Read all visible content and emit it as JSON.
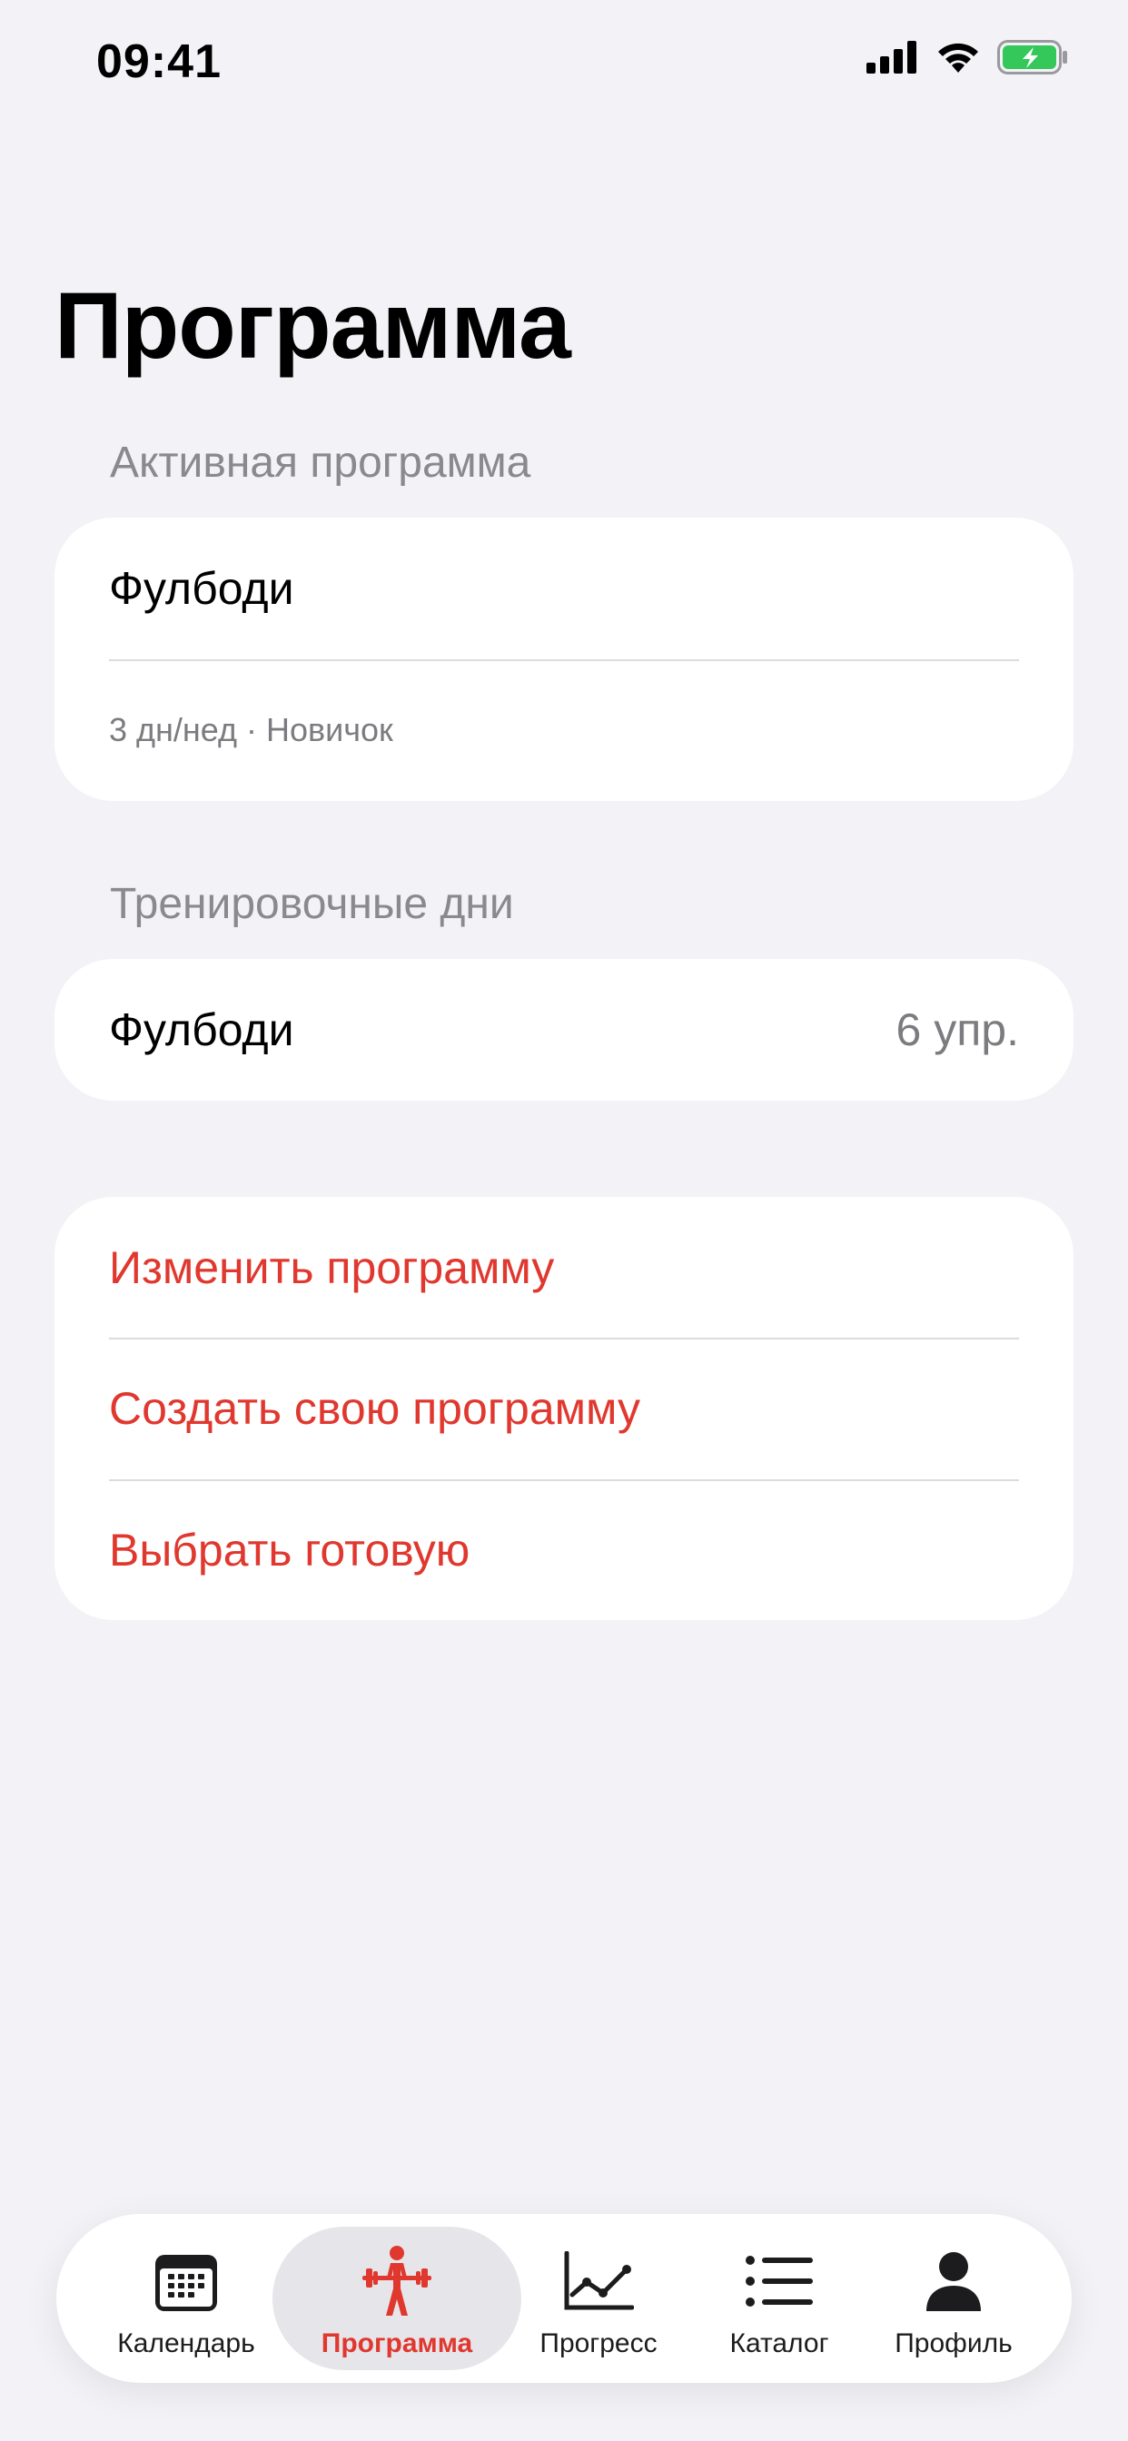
{
  "status_bar": {
    "time": "09:41",
    "icons": [
      "cellular-signal-icon",
      "wifi-icon",
      "battery-charging-icon"
    ],
    "battery_color": "#34C759"
  },
  "page": {
    "title": "Программа"
  },
  "active_program": {
    "header": "Активная программа",
    "name": "Фулбоди",
    "details": "3 дн/нед · Новичок"
  },
  "training_days": {
    "header": "Тренировочные дни",
    "items": [
      {
        "name": "Фулбоди",
        "exercises": "6 упр."
      }
    ]
  },
  "actions": {
    "items": [
      {
        "label": "Изменить программу"
      },
      {
        "label": "Создать свою программу"
      },
      {
        "label": "Выбрать готовую"
      }
    ],
    "color": "#E0382F"
  },
  "tab_bar": {
    "active_color": "#E0382F",
    "tabs": [
      {
        "label": "Календарь",
        "icon": "calendar-icon",
        "active": false
      },
      {
        "label": "Программа",
        "icon": "weightlifter-icon",
        "active": true
      },
      {
        "label": "Прогресс",
        "icon": "chart-line-icon",
        "active": false
      },
      {
        "label": "Каталог",
        "icon": "list-icon",
        "active": false
      },
      {
        "label": "Профиль",
        "icon": "person-icon",
        "active": false
      }
    ]
  }
}
